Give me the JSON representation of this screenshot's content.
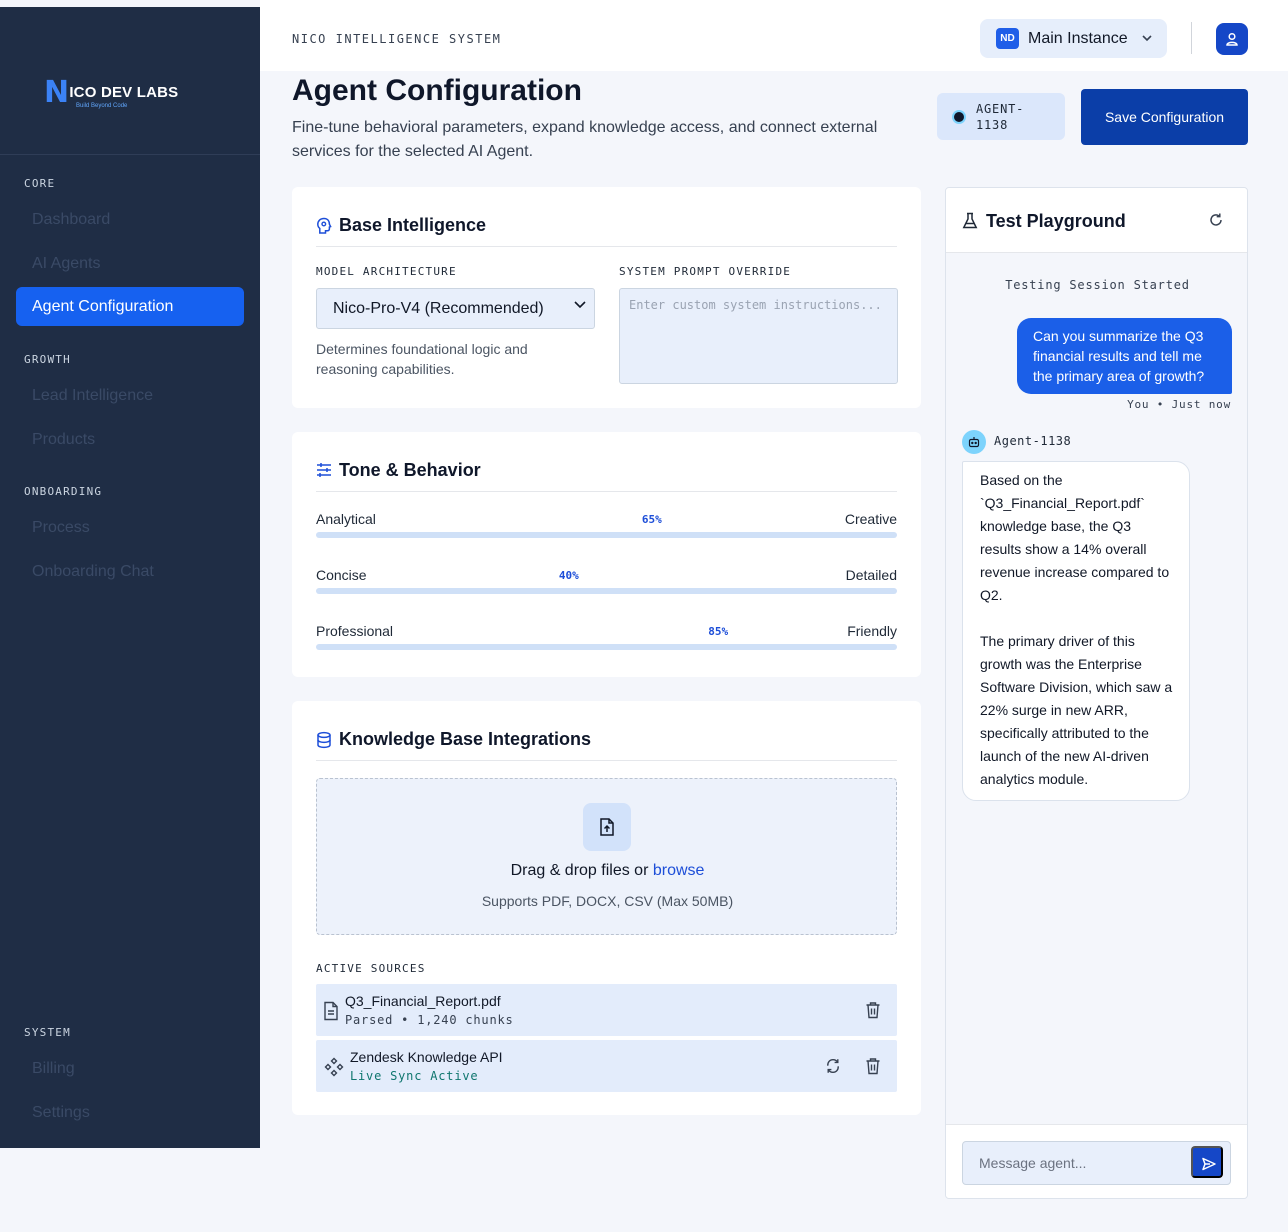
{
  "brand": {
    "logo_letter": "N",
    "logo_rest": "ICO DEV LABS",
    "logo_tagline": "Build Beyond Code"
  },
  "sidebar": {
    "sections": [
      {
        "label": "CORE",
        "items": [
          "Dashboard",
          "AI Agents",
          "Agent Configuration"
        ]
      },
      {
        "label": "GROWTH",
        "items": [
          "Lead Intelligence",
          "Products"
        ]
      },
      {
        "label": "ONBOARDING",
        "items": [
          "Process",
          "Onboarding Chat"
        ]
      },
      {
        "label": "SYSTEM",
        "items": [
          "Billing",
          "Settings"
        ]
      }
    ],
    "active_item": "Agent Configuration"
  },
  "topbar": {
    "system_title": "NICO INTELLIGENCE SYSTEM",
    "instance_badge": "ND",
    "instance_label": "Main Instance"
  },
  "header": {
    "title": "Agent Configuration",
    "description": "Fine-tune behavioral parameters, expand knowledge access, and connect external services for the selected AI Agent.",
    "agent_id": "AGENT-1138",
    "save_label": "Save Configuration"
  },
  "base_intelligence": {
    "title": "Base Intelligence",
    "model_label": "MODEL ARCHITECTURE",
    "model_value": "Nico-Pro-V4 (Recommended)",
    "model_helper": "Determines foundational logic and reasoning capabilities.",
    "prompt_label": "SYSTEM PROMPT OVERRIDE",
    "prompt_placeholder": "Enter custom system instructions..."
  },
  "tone": {
    "title": "Tone & Behavior",
    "sliders": [
      {
        "left": "Analytical",
        "right": "Creative",
        "value": 65,
        "value_label": "65%"
      },
      {
        "left": "Concise",
        "right": "Detailed",
        "value": 40,
        "value_label": "40%"
      },
      {
        "left": "Professional",
        "right": "Friendly",
        "value": 85,
        "value_label": "85%"
      }
    ]
  },
  "knowledge": {
    "title": "Knowledge Base Integrations",
    "dropzone_text": "Drag & drop files or ",
    "dropzone_link": "browse",
    "dropzone_sub": "Supports PDF, DOCX, CSV (Max 50MB)",
    "sources_label": "ACTIVE SOURCES",
    "sources": [
      {
        "name": "Q3_Financial_Report.pdf",
        "status": "Parsed • 1,240 chunks"
      },
      {
        "name": "Zendesk Knowledge API",
        "status": "Live Sync Active"
      }
    ]
  },
  "playground": {
    "title": "Test Playground",
    "session_text": "Testing Session Started",
    "user_message": "Can you summarize the Q3 financial results and tell me the primary area of growth?",
    "user_meta": "You • Just now",
    "bot_name": "Agent-1138",
    "bot_message_p1": "Based on the `Q3_Financial_Report.pdf` knowledge base, the Q3 results show a 14% overall revenue increase compared to Q2.",
    "bot_message_p2": "The primary driver of this growth was the Enterprise Software Division, which saw a 22% surge in new ARR, specifically attributed to the launch of the new AI-driven analytics module.",
    "input_placeholder": "Message agent..."
  },
  "colors": {
    "primary": "#1661f0",
    "sidebar": "#1f2d45",
    "save_button": "#0b3ea8"
  }
}
